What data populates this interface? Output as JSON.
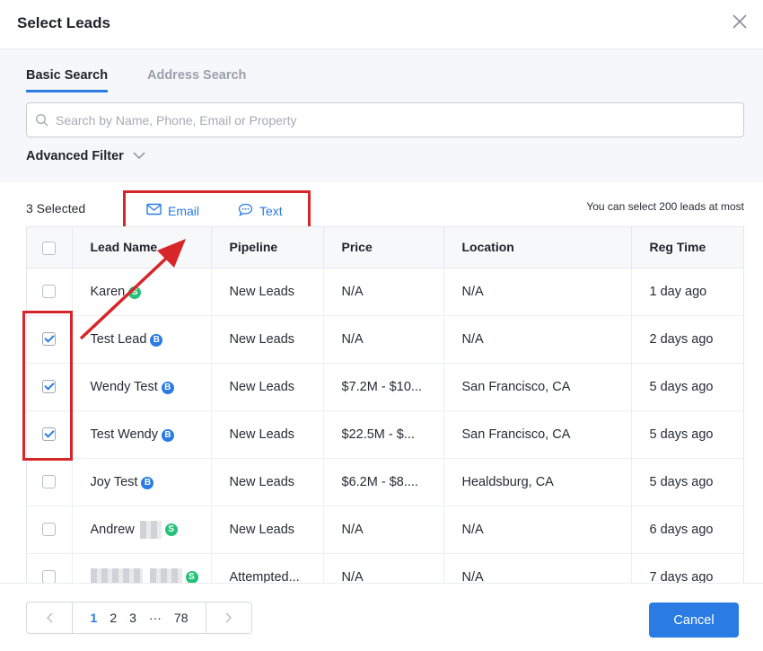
{
  "modal": {
    "title": "Select Leads"
  },
  "tabs": [
    {
      "label": "Basic Search",
      "active": true
    },
    {
      "label": "Address Search",
      "active": false
    }
  ],
  "search": {
    "placeholder": "Search by Name, Phone, Email or Property",
    "value": ""
  },
  "advanced_filter": {
    "label": "Advanced Filter"
  },
  "toolbar": {
    "selected_count": "3 Selected",
    "email_label": "Email",
    "text_label": "Text",
    "limit_note": "You can select 200 leads at most"
  },
  "table": {
    "columns": [
      "Lead Name",
      "Pipeline",
      "Price",
      "Location",
      "Reg Time"
    ],
    "rows": [
      {
        "name": "Karen",
        "badge": "S",
        "checked": false,
        "pipeline": "New Leads",
        "price": "N/A",
        "location": "N/A",
        "reg_time": "1 day ago"
      },
      {
        "name": "Test Lead",
        "badge": "B",
        "checked": true,
        "pipeline": "New Leads",
        "price": "N/A",
        "location": "N/A",
        "reg_time": "2 days ago"
      },
      {
        "name": "Wendy Test",
        "badge": "B",
        "checked": true,
        "pipeline": "New Leads",
        "price": "$7.2M - $10...",
        "location": "San Francisco, CA",
        "reg_time": "5 days ago"
      },
      {
        "name": "Test Wendy",
        "badge": "B",
        "checked": true,
        "pipeline": "New Leads",
        "price": "$22.5M - $...",
        "location": "San Francisco, CA",
        "reg_time": "5 days ago"
      },
      {
        "name": "Joy Test",
        "badge": "B",
        "checked": false,
        "pipeline": "New Leads",
        "price": "$6.2M - $8....",
        "location": "Healdsburg, CA",
        "reg_time": "5 days ago"
      },
      {
        "name": "Andrew",
        "badge": "S",
        "checked": false,
        "pipeline": "New Leads",
        "price": "N/A",
        "location": "N/A",
        "reg_time": "6 days ago"
      },
      {
        "name": "",
        "badge": "S",
        "checked": false,
        "pipeline": "Attempted...",
        "price": "N/A",
        "location": "N/A",
        "reg_time": "7 days ago"
      }
    ]
  },
  "pagination": {
    "pages": [
      "1",
      "2",
      "3",
      "···",
      "78"
    ],
    "current": "1"
  },
  "footer": {
    "cancel_label": "Cancel"
  },
  "colors": {
    "accent": "#2a7be4",
    "annotation_red": "#d7262a",
    "badge_seller": "#27c17a",
    "badge_buyer": "#2a7be4"
  }
}
